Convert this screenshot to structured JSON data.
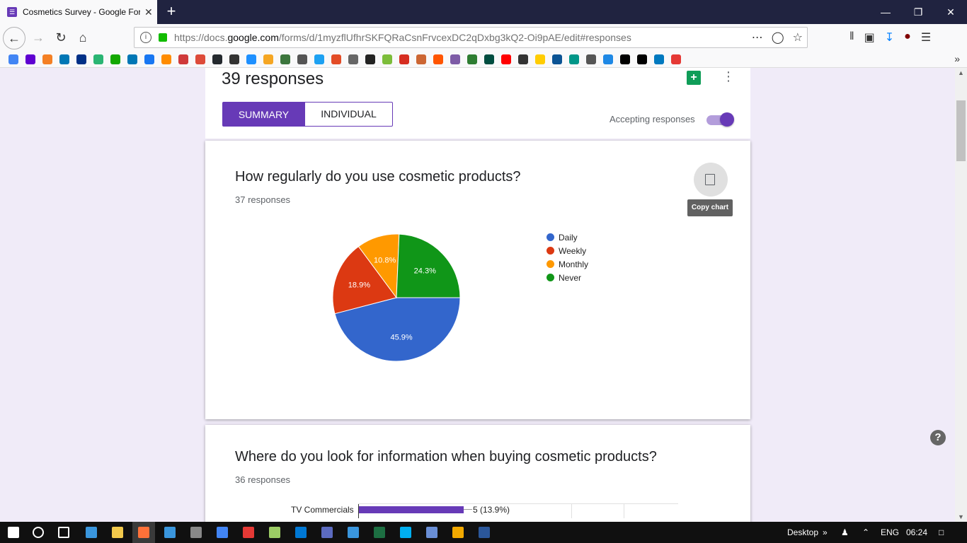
{
  "browser": {
    "tab_title": "Cosmetics Survey - Google Forms",
    "new_tab_symbol": "+",
    "url_prefix": "https://docs.",
    "url_domain": "google.com",
    "url_rest": "/forms/d/1myzflUfhrSKFQRaCsnFrvcexDC2qDxbg3kQ2-Oi9pAE/edit#responses",
    "bookmark_count": 40
  },
  "form": {
    "response_count": "39 responses",
    "tabs": [
      "SUMMARY",
      "INDIVIDUAL"
    ],
    "accepting_label": "Accepting responses",
    "accepting_on": true
  },
  "question1": {
    "title": "How regularly do you use cosmetic products?",
    "responses": "37 responses",
    "copy_tooltip": "Copy chart"
  },
  "chart_data": {
    "type": "pie",
    "categories": [
      "Daily",
      "Weekly",
      "Monthly",
      "Never"
    ],
    "values": [
      45.9,
      18.9,
      10.8,
      24.3
    ],
    "labels": [
      "45.9%",
      "18.9%",
      "10.8%",
      "24.3%"
    ],
    "colors": [
      "#3366cc",
      "#dc3912",
      "#ff9900",
      "#109618"
    ],
    "legend_position": "right"
  },
  "question2": {
    "title": "Where do you look for information when buying cosmetic products?",
    "responses": "36 responses",
    "first_bar_label": "TV Commercials",
    "first_bar_value": "5 (13.9%)",
    "bar_color": "#673ab7"
  },
  "taskbar": {
    "desktop_label": "Desktop",
    "language": "ENG",
    "time": "06:24"
  }
}
